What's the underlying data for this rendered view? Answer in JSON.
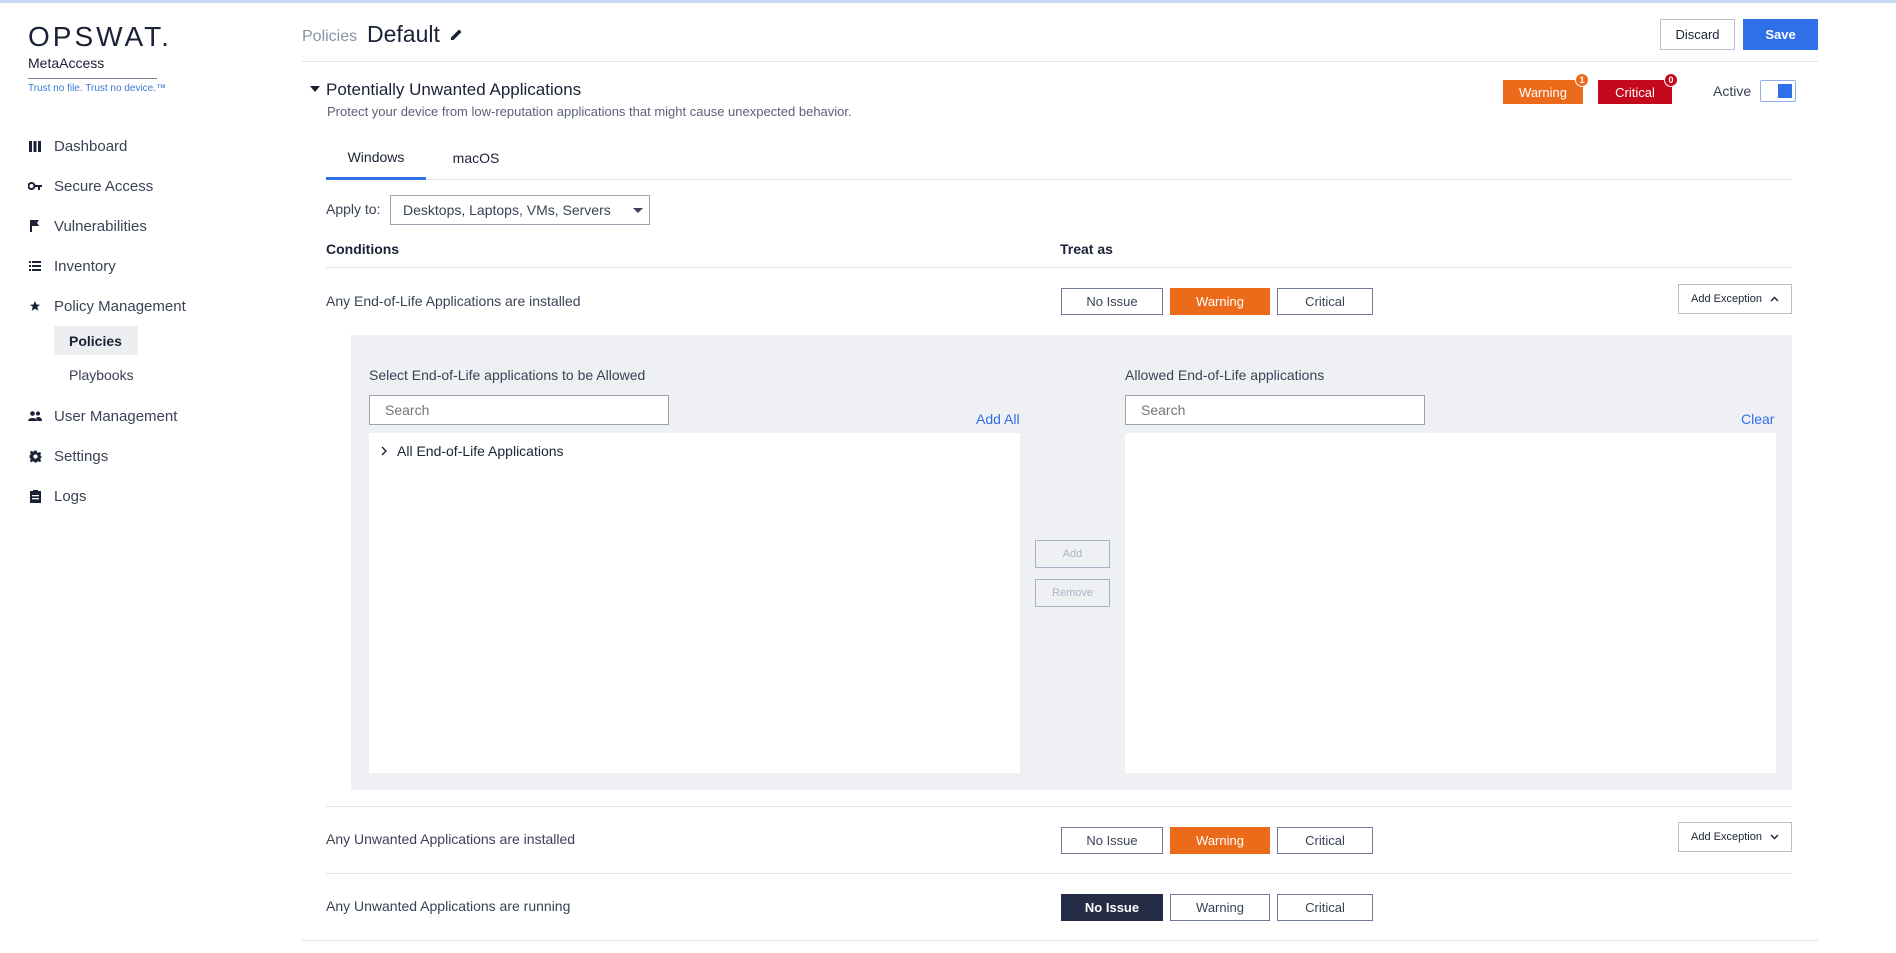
{
  "brand": {
    "logo_word": "OPSWAT.",
    "product": "MetaAccess",
    "tagline": "Trust no file. Trust no device.™"
  },
  "sidebar": {
    "items": [
      {
        "label": "Dashboard",
        "icon": "dashboard-icon"
      },
      {
        "label": "Secure Access",
        "icon": "key-icon"
      },
      {
        "label": "Vulnerabilities",
        "icon": "flag-icon"
      },
      {
        "label": "Inventory",
        "icon": "list-icon"
      },
      {
        "label": "Policy Management",
        "icon": "star-icon"
      },
      {
        "label": "User Management",
        "icon": "users-icon"
      },
      {
        "label": "Settings",
        "icon": "gear-icon"
      },
      {
        "label": "Logs",
        "icon": "clipboard-icon"
      }
    ],
    "sub_items": [
      {
        "label": "Policies",
        "active": true
      },
      {
        "label": "Playbooks",
        "active": false
      }
    ]
  },
  "header": {
    "breadcrumb": "Policies",
    "title": "Default",
    "discard_label": "Discard",
    "save_label": "Save"
  },
  "section": {
    "title": "Potentially Unwanted Applications",
    "description": "Protect your device from low-reputation applications that might cause unexpected behavior.",
    "warning_label": "Warning",
    "warning_count": "1",
    "critical_label": "Critical",
    "critical_count": "0",
    "active_label": "Active",
    "active": true
  },
  "tabs": [
    {
      "label": "Windows",
      "selected": true
    },
    {
      "label": "macOS",
      "selected": false
    }
  ],
  "apply_to": {
    "label": "Apply to:",
    "value": "Desktops, Laptops, VMs, Servers"
  },
  "table": {
    "col_conditions": "Conditions",
    "col_treat_as": "Treat as",
    "options": {
      "no_issue": "No Issue",
      "warning": "Warning",
      "critical": "Critical"
    },
    "rows": [
      {
        "condition": "Any End-of-Life Applications are installed",
        "selected": "Warning",
        "exception_label": "Add Exception",
        "expanded": true
      },
      {
        "condition": "Any Unwanted Applications are installed",
        "selected": "Warning",
        "exception_label": "Add Exception",
        "expanded": false
      },
      {
        "condition": "Any Unwanted Applications are running",
        "selected": "No Issue"
      }
    ]
  },
  "exception_panel": {
    "left_title": "Select End-of-Life applications to be Allowed",
    "left_search_placeholder": "Search",
    "add_all_label": "Add All",
    "tree_item": "All End-of-Life Applications",
    "add_label": "Add",
    "remove_label": "Remove",
    "right_title": "Allowed End-of-Life applications",
    "right_search_placeholder": "Search",
    "clear_label": "Clear"
  },
  "colors": {
    "accent": "#2f6fe8",
    "warning": "#ec6b1a",
    "critical": "#c5091d",
    "navy": "#242d45"
  }
}
